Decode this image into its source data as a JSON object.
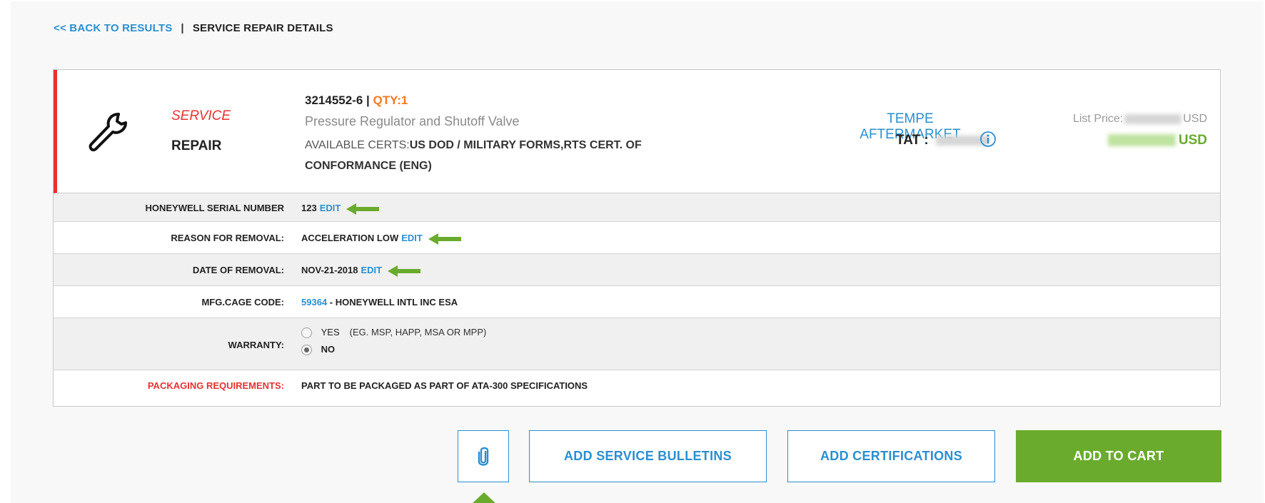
{
  "breadcrumb": {
    "back_label": "<< BACK TO RESULTS",
    "separator": "|",
    "current": "SERVICE REPAIR DETAILS"
  },
  "service": {
    "type": "SERVICE",
    "name": "REPAIR",
    "icon": "wrench-icon"
  },
  "part": {
    "number": "3214552-6 |",
    "qty": "QTY:1",
    "description": "Pressure Regulator and Shutoff Valve",
    "certs_label": "AVAILABLE CERTS:",
    "certs_value": "US DOD / MILITARY FORMS,RTS CERT. OF CONFORMANCE (ENG)"
  },
  "location": {
    "name": "TEMPE AFTERMARKET",
    "tat_label": "TAT :"
  },
  "pricing": {
    "list_label": "List Price:",
    "list_currency": "USD",
    "net_currency": "USD"
  },
  "details": [
    {
      "label": "HONEYWELL SERIAL NUMBER",
      "value": "123",
      "edit": "EDIT"
    },
    {
      "label": "REASON FOR REMOVAL:",
      "value": "ACCELERATION LOW",
      "edit": "EDIT"
    },
    {
      "label": "DATE OF REMOVAL:",
      "value": "NOV-21-2018",
      "edit": "EDIT"
    },
    {
      "label": "MFG.CAGE CODE:",
      "code": "59364",
      "value": "- HONEYWELL INTL INC ESA"
    },
    {
      "label": "WARRANTY:",
      "options": [
        "YES",
        "NO"
      ],
      "selected": "NO",
      "note": "(EG. MSP, HAPP, MSA OR MPP)"
    },
    {
      "label": "PACKAGING REQUIREMENTS:",
      "value": "PART TO BE PACKAGED AS PART OF ATA-300 SPECIFICATIONS"
    }
  ],
  "actions": {
    "attach_icon": "paperclip-icon",
    "service_bulletins": "ADD SERVICE BULLETINS",
    "certifications": "ADD CERTIFICATIONS",
    "add_to_cart": "ADD TO CART"
  },
  "colors": {
    "accent_blue": "#2a8fd0",
    "accent_red": "#e63232",
    "accent_orange": "#f47920",
    "accent_green": "#6aab2d"
  }
}
